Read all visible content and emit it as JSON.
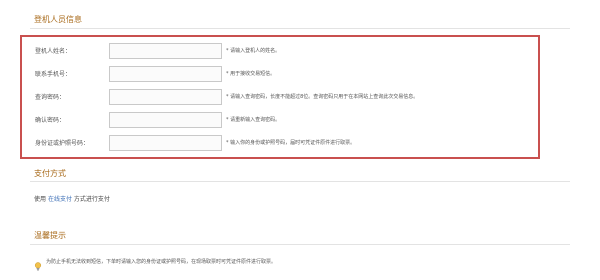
{
  "registrant_section": {
    "title": "登机人员信息",
    "fields": [
      {
        "label": "登机人姓名：",
        "value": "",
        "hint": "* 请输入登机人的姓名。"
      },
      {
        "label": "联系手机号：",
        "value": "",
        "hint": "* 用于接收交易短信。"
      },
      {
        "label": "查询密码：",
        "value": "",
        "hint": "* 请输入查询密码，长度不能超过8位。查询密码只用于在本网站上查询此次交易信息。"
      },
      {
        "label": "确认密码：",
        "value": "",
        "hint": "* 请重新输入查询密码。"
      },
      {
        "label": "身份证或护照号码：",
        "value": "",
        "hint": "* 输入你的身份或护照号码，届时可凭证件原件进行取票。"
      }
    ]
  },
  "payment_section": {
    "title": "支付方式",
    "text_before": "使用",
    "method_link": "在线支付",
    "text_after": "方式进行支付"
  },
  "tips_section": {
    "title": "温馨提示",
    "icon": "lightbulb-icon",
    "notice": "为防止手机无法收到短信，下单时请输入您的身份证或护照号码，在现场取票时可凭证件原件进行取票。"
  },
  "colors": {
    "accent": "#a86a1a",
    "highlight_border": "#c9504f",
    "link": "#3a6db5"
  }
}
